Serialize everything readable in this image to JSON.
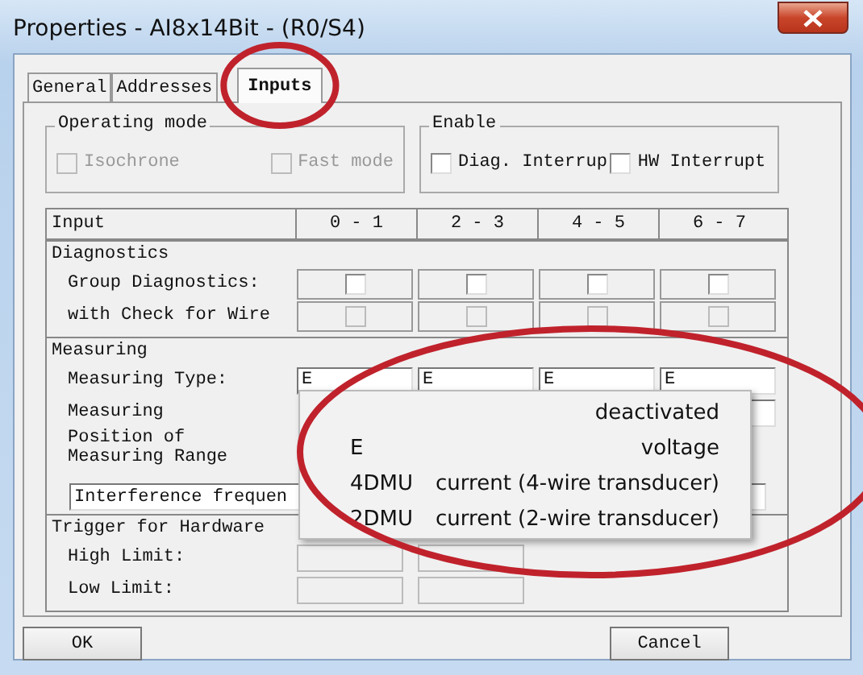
{
  "window": {
    "title": "Properties - AI8x14Bit - (R0/S4)"
  },
  "tabs": [
    {
      "label": "General",
      "selected": false,
      "circled": false
    },
    {
      "label": "Addresses",
      "selected": false,
      "circled": false
    },
    {
      "label": "Inputs",
      "selected": true,
      "circled": true
    }
  ],
  "groups": [
    {
      "title": "Operating mode",
      "options": [
        {
          "label": "Isochrone",
          "checked": false,
          "disabled": true
        },
        {
          "label": "Fast mode",
          "checked": false,
          "disabled": true
        }
      ]
    },
    {
      "title": "Enable",
      "options": [
        {
          "label": "Diag. Interrup",
          "checked": false,
          "disabled": false
        },
        {
          "label": "HW Interrupt",
          "checked": false,
          "disabled": false
        }
      ]
    }
  ],
  "table": {
    "header": "Input",
    "columns": [
      "0 - 1",
      "2 - 3",
      "4 - 5",
      "6 - 7"
    ],
    "sections": [
      {
        "title": "Diagnostics",
        "rows": [
          {
            "kind": "checkbox",
            "label": "Group Diagnostics:",
            "cells": [
              {
                "checked": false,
                "disabled": false
              },
              {
                "checked": false,
                "disabled": false
              },
              {
                "checked": false,
                "disabled": false
              },
              {
                "checked": false,
                "disabled": false
              }
            ]
          },
          {
            "kind": "checkbox",
            "label": "with Check for Wire",
            "cells": [
              {
                "checked": false,
                "disabled": true
              },
              {
                "checked": false,
                "disabled": true
              },
              {
                "checked": false,
                "disabled": true
              },
              {
                "checked": false,
                "disabled": true
              }
            ]
          }
        ]
      },
      {
        "title": "Measuring",
        "rows": [
          {
            "kind": "select",
            "label": "Measuring Type:",
            "cells": [
              "E",
              "E",
              "E",
              "E"
            ]
          },
          {
            "kind": "blank",
            "label": "Measuring"
          },
          {
            "kind": "label",
            "label": "Position of Measuring Range"
          },
          {
            "kind": "wide",
            "value": "Interference frequen"
          }
        ]
      },
      {
        "title": "Trigger for Hardware",
        "rows": [
          {
            "kind": "limit",
            "label": "High Limit:"
          },
          {
            "kind": "limit",
            "label": "Low Limit:"
          }
        ]
      }
    ]
  },
  "dropdown": {
    "circled": true,
    "items": [
      {
        "text": "deactivated"
      },
      {
        "code": "E",
        "text": "voltage"
      },
      {
        "code": "4DMU",
        "text": "current (4-wire transducer)"
      },
      {
        "code": "2DMU",
        "text": "current (2-wire transducer)"
      }
    ]
  },
  "buttons": [
    "OK",
    "Cancel"
  ]
}
